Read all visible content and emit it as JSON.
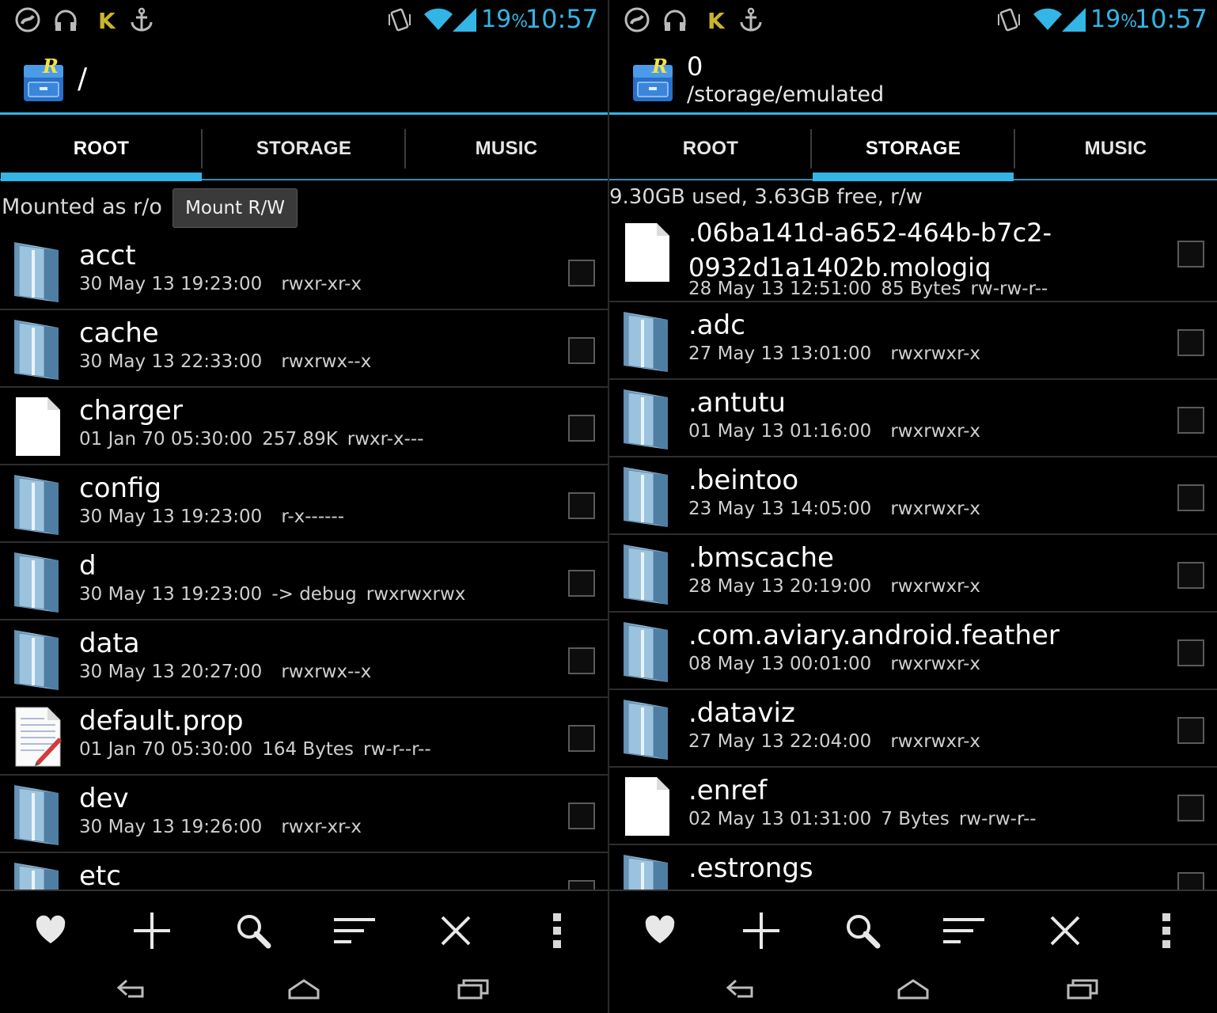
{
  "status": {
    "battery": "19",
    "battery_unit": "%",
    "time": "10:57"
  },
  "panes": [
    {
      "title": "/",
      "subtitle": "",
      "tabs": [
        "ROOT",
        "STORAGE",
        "MUSIC"
      ],
      "active_tab": 0,
      "mount_text": "Mounted as r/o",
      "mount_button": "Mount R/W",
      "storage_info": "",
      "items": [
        {
          "name": "acct",
          "date": "30 May 13 19:23:00",
          "detail": "",
          "perm": "rwxr-xr-x",
          "icon": "folder-icon"
        },
        {
          "name": "cache",
          "date": "30 May 13 22:33:00",
          "detail": "",
          "perm": "rwxrwx--x",
          "icon": "folder-icon"
        },
        {
          "name": "charger",
          "date": "01 Jan 70 05:30:00",
          "detail": "257.89K",
          "perm": "rwxr-x---",
          "icon": "file-icon"
        },
        {
          "name": "config",
          "date": "30 May 13 19:23:00",
          "detail": "",
          "perm": "r-x------",
          "icon": "folder-icon"
        },
        {
          "name": "d",
          "date": "30 May 13 19:23:00",
          "detail": "-> debug",
          "perm": "rwxrwxrwx",
          "icon": "folder-icon"
        },
        {
          "name": "data",
          "date": "30 May 13 20:27:00",
          "detail": "",
          "perm": "rwxrwx--x",
          "icon": "folder-icon"
        },
        {
          "name": "default.prop",
          "date": "01 Jan 70 05:30:00",
          "detail": "164 Bytes",
          "perm": "rw-r--r--",
          "icon": "text-file-icon"
        },
        {
          "name": "dev",
          "date": "30 May 13 19:26:00",
          "detail": "",
          "perm": "rwxr-xr-x",
          "icon": "folder-icon"
        },
        {
          "name": "etc",
          "date": "",
          "detail": "",
          "perm": "",
          "icon": "folder-icon"
        }
      ]
    },
    {
      "title": "0",
      "subtitle": "/storage/emulated",
      "tabs": [
        "ROOT",
        "STORAGE",
        "MUSIC"
      ],
      "active_tab": 1,
      "mount_text": "",
      "mount_button": "",
      "storage_info": "9.30GB used, 3.63GB free, r/w",
      "items": [
        {
          "name": ".06ba141d-a652-464b-b7c2-0932d1a1402b.mologiq",
          "date": "28 May 13 12:51:00",
          "detail": "85 Bytes",
          "perm": "rw-rw-r--",
          "icon": "file-icon",
          "tall": true
        },
        {
          "name": ".adc",
          "date": "27 May 13 13:01:00",
          "detail": "",
          "perm": "rwxrwxr-x",
          "icon": "folder-icon"
        },
        {
          "name": ".antutu",
          "date": "01 May 13 01:16:00",
          "detail": "",
          "perm": "rwxrwxr-x",
          "icon": "folder-icon"
        },
        {
          "name": ".beintoo",
          "date": "23 May 13 14:05:00",
          "detail": "",
          "perm": "rwxrwxr-x",
          "icon": "folder-icon"
        },
        {
          "name": ".bmscache",
          "date": "28 May 13 20:19:00",
          "detail": "",
          "perm": "rwxrwxr-x",
          "icon": "folder-icon"
        },
        {
          "name": ".com.aviary.android.feather",
          "date": "08 May 13 00:01:00",
          "detail": "",
          "perm": "rwxrwxr-x",
          "icon": "folder-icon"
        },
        {
          "name": ".dataviz",
          "date": "27 May 13 22:04:00",
          "detail": "",
          "perm": "rwxrwxr-x",
          "icon": "folder-icon"
        },
        {
          "name": ".enref",
          "date": "02 May 13 01:31:00",
          "detail": "7 Bytes",
          "perm": "rw-rw-r--",
          "icon": "file-icon"
        },
        {
          "name": ".estrongs",
          "date": "",
          "detail": "",
          "perm": "",
          "icon": "folder-icon"
        }
      ]
    }
  ],
  "toolbar_icons": [
    "favorite-icon",
    "add-icon",
    "search-icon",
    "sort-icon",
    "close-icon",
    "overflow-menu-icon"
  ],
  "nav_icons": [
    "back-icon",
    "home-icon",
    "recent-apps-icon"
  ],
  "colors": {
    "accent": "#33b5e5",
    "background": "#000000"
  }
}
